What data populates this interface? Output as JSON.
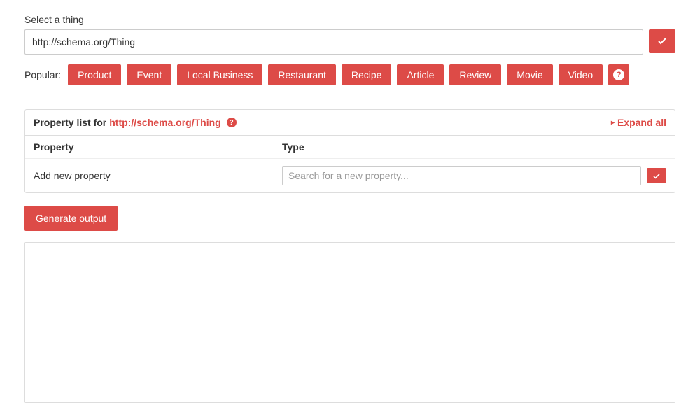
{
  "select_thing": {
    "label": "Select a thing",
    "value": "http://schema.org/Thing"
  },
  "popular": {
    "label": "Popular:",
    "items": [
      "Product",
      "Event",
      "Local Business",
      "Restaurant",
      "Recipe",
      "Article",
      "Review",
      "Movie",
      "Video"
    ]
  },
  "panel": {
    "title_prefix": "Property list for ",
    "title_link": "http://schema.org/Thing",
    "expand_all": "Expand all"
  },
  "table": {
    "header_property": "Property",
    "header_type": "Type",
    "add_new_label": "Add new property",
    "search_placeholder": "Search for a new property..."
  },
  "actions": {
    "generate": "Generate output"
  },
  "colors": {
    "accent": "#dd4b47"
  }
}
